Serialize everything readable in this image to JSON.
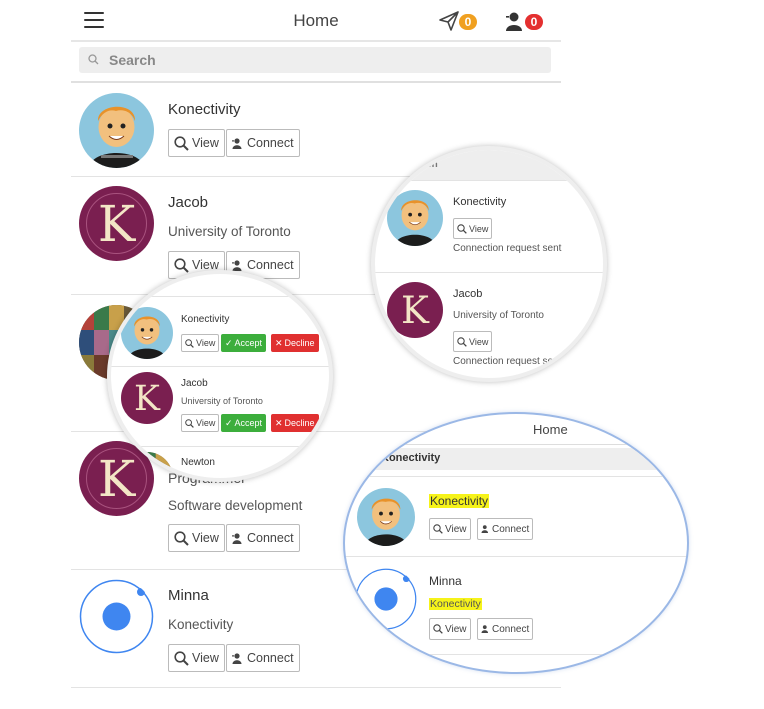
{
  "header": {
    "title": "Home",
    "messages_badge": "0",
    "requests_badge": "0"
  },
  "search": {
    "placeholder": "Search"
  },
  "buttons": {
    "view": "View",
    "connect": "Connect",
    "accept": "Accept",
    "decline": "Decline"
  },
  "list": {
    "items": [
      {
        "name": "Konectivity",
        "avatar": "mascot"
      },
      {
        "name": "Jacob",
        "subtitle": "University of Toronto",
        "avatar": "k-logo"
      },
      {
        "name": "",
        "avatar": "mosaic"
      },
      {
        "name": "Programmer",
        "subtitle": "Software development",
        "avatar": "k-logo"
      },
      {
        "name": "Minna",
        "subtitle": "Konectivity",
        "avatar": "blue-dot"
      }
    ]
  },
  "zoom_requests": {
    "items": [
      {
        "name": "Konectivity"
      },
      {
        "name": "Jacob",
        "subtitle": "University of Toronto"
      },
      {
        "name": "Newton"
      }
    ]
  },
  "zoom_sent": {
    "search_partial": "earch",
    "status": "Connection request sent",
    "items": [
      {
        "name": "Konectivity"
      },
      {
        "name": "Jacob",
        "subtitle": "University of Toronto"
      }
    ]
  },
  "zoom_search": {
    "title": "Home",
    "query": "Konectivity",
    "items": [
      {
        "name": "Konectivity"
      },
      {
        "name": "Minna",
        "subtitle": "Konectivity"
      }
    ]
  },
  "colors": {
    "accept": "#3cae3c",
    "decline": "#e03030",
    "highlight": "#f6f31a",
    "badge_orange": "#f0a020",
    "badge_red": "#e43030",
    "k_purple": "#7a1f50",
    "dot_blue": "#3f86f0"
  }
}
